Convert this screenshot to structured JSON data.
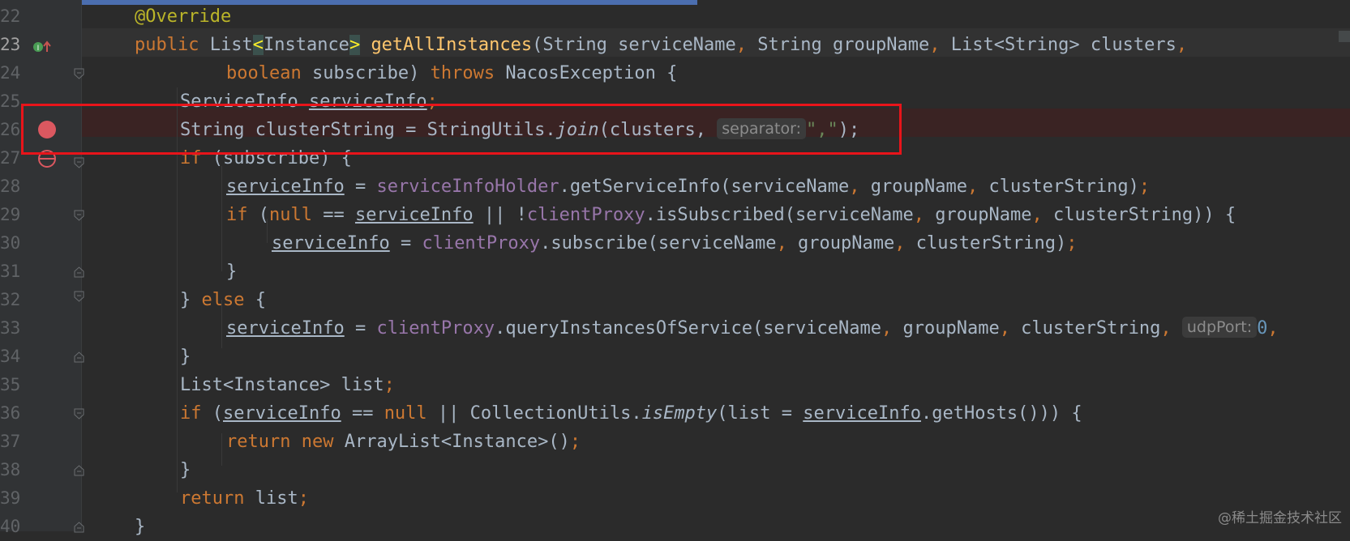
{
  "editor": {
    "lines": [
      {
        "num": "22"
      },
      {
        "num": "23"
      },
      {
        "num": "24"
      },
      {
        "num": "25"
      },
      {
        "num": "26"
      },
      {
        "num": "27"
      },
      {
        "num": "28"
      },
      {
        "num": "29"
      },
      {
        "num": "30"
      },
      {
        "num": "31"
      },
      {
        "num": "32"
      },
      {
        "num": "33"
      },
      {
        "num": "34"
      },
      {
        "num": "35"
      },
      {
        "num": "36"
      },
      {
        "num": "37"
      },
      {
        "num": "38"
      },
      {
        "num": "39"
      },
      {
        "num": "40"
      }
    ],
    "code": {
      "l22": {
        "ann": "@Override"
      },
      "l23": {
        "kw_public": "public",
        "type_list": " List",
        "lt": "<",
        "type_instance": "Instance",
        "gt": ">",
        "fn": "getAllInstances",
        "params": "(String serviceName",
        "c1": ",",
        "p2": " String groupName",
        "c2": ",",
        "p3": " List<String> clusters",
        "c3": ","
      },
      "l24": {
        "kw_boolean": "boolean",
        "rest": " subscribe) ",
        "kw_throws": "throws",
        "exc": " NacosException {"
      },
      "l25": {
        "type": "ServiceInfo ",
        "var": "serviceInfo",
        "semi": ";"
      },
      "l26": {
        "pre": "String clusterString = StringUtils.",
        "method": "join",
        "args": "(clusters, ",
        "hint": "separator:",
        "str": "\",\"",
        "end": ");"
      },
      "l27": {
        "kw_if": "if",
        "rest": " (subscribe) {"
      },
      "l28": {
        "var": "serviceInfo",
        "eq": " = ",
        "field": "serviceInfoHolder",
        "rest": ".getServiceInfo(serviceName",
        "c1": ",",
        "p2": " groupName",
        "c2": ",",
        "p3": " clusterString)",
        "semi": ";"
      },
      "l29": {
        "kw_if": "if",
        "open": " (",
        "kw_null": "null",
        "eq": " == ",
        "var": "serviceInfo",
        "or": " || !",
        "field": "clientProxy",
        "rest": ".isSubscribed(serviceName",
        "c1": ",",
        "p2": " groupName",
        "c2": ",",
        "p3": " clusterString)) {"
      },
      "l30": {
        "var": "serviceInfo",
        "eq": " = ",
        "field": "clientProxy",
        "rest": ".subscribe(serviceName",
        "c1": ",",
        "p2": " groupName",
        "c2": ",",
        "p3": " clusterString)",
        "semi": ";"
      },
      "l31": {
        "brace": "}"
      },
      "l32": {
        "brace": "} ",
        "kw_else": "else",
        "open": " {"
      },
      "l33": {
        "var": "serviceInfo",
        "eq": " = ",
        "field": "clientProxy",
        "rest": ".queryInstancesOfService(serviceName",
        "c1": ",",
        "p2": " groupName",
        "c2": ",",
        "p3": " clusterString",
        "c3": ",",
        "hint": "udpPort:",
        "num": "0",
        "c4": ","
      },
      "l34": {
        "brace": "}"
      },
      "l35": {
        "type": "List<Instance> list",
        "semi": ";"
      },
      "l36": {
        "kw_if": "if",
        "open": " (",
        "var": "serviceInfo",
        "eq": " == ",
        "kw_null": "null",
        "or": " || CollectionUtils.",
        "method": "isEmpty",
        "mid": "(list = ",
        "var2": "serviceInfo",
        "end": ".getHosts())) {"
      },
      "l37": {
        "kw_return": "return",
        "kw_new": " new",
        "rest": " ArrayList<Instance>()",
        "semi": ";"
      },
      "l38": {
        "brace": "}"
      },
      "l39": {
        "kw_return": "return",
        "rest": " list",
        "semi": ";"
      },
      "l40": {
        "brace": "}"
      }
    }
  },
  "watermark": "@稀土掘金技术社区",
  "colors": {
    "background": "#2b2b2b",
    "keyword": "#cc7832",
    "annotation": "#bbb529",
    "function": "#ffc66d",
    "field": "#9876aa",
    "number": "#6897bb",
    "string": "#6a8759",
    "breakpoint": "#db5860",
    "highlight_box": "#e8141a"
  },
  "icons": {
    "line23": "implements-method-icon",
    "line26": "breakpoint-icon",
    "line27": "disabled-breakpoint-icon"
  }
}
